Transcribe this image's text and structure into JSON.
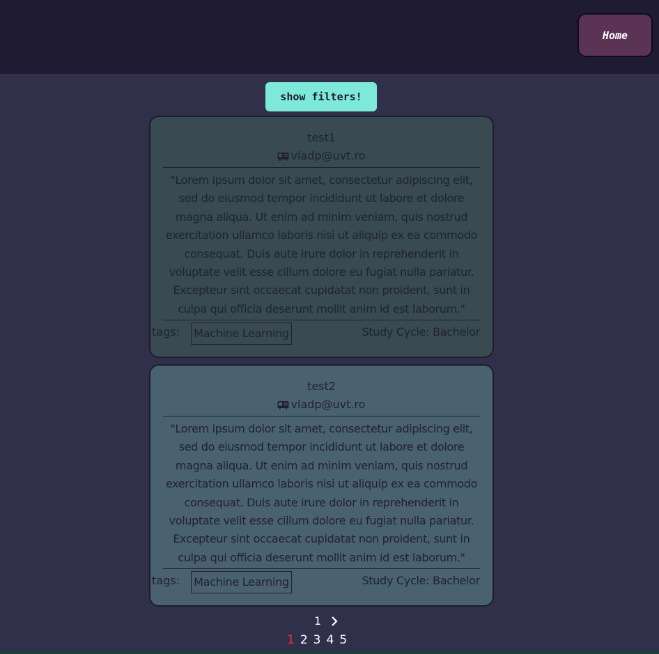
{
  "header": {
    "home_label": "Home"
  },
  "filters": {
    "button_label": "show filters!"
  },
  "cards": [
    {
      "title": "test1",
      "email": "vladp@uvt.ro",
      "description": "\"Lorem ipsum dolor sit amet, consectetur adipiscing elit, sed do eiusmod tempor incididunt ut labore et dolore magna aliqua. Ut enim ad minim veniam, quis nostrud exercitation ullamco laboris nisi ut aliquip ex ea commodo consequat. Duis aute irure dolor in reprehenderit in voluptate velit esse cillum dolore eu fugiat nulla pariatur. Excepteur sint occaecat cupidatat non proident, sunt in culpa qui officia deserunt mollit anim id est laborum.\"",
      "tags_label": "tags:",
      "tag": "Machine Learning",
      "study_cycle": "Study Cycle: Bachelor"
    },
    {
      "title": "test2",
      "email": "vladp@uvt.ro",
      "description": "\"Lorem ipsum dolor sit amet, consectetur adipiscing elit, sed do eiusmod tempor incididunt ut labore et dolore magna aliqua. Ut enim ad minim veniam, quis nostrud exercitation ullamco laboris nisi ut aliquip ex ea commodo consequat. Duis aute irure dolor in reprehenderit in voluptate velit esse cillum dolore eu fugiat nulla pariatur. Excepteur sint occaecat cupidatat non proident, sunt in culpa qui officia deserunt mollit anim id est laborum.\"",
      "tags_label": "tags:",
      "tag": "Machine Learning",
      "study_cycle": "Study Cycle: Bachelor"
    }
  ],
  "pagination": {
    "current_page": "1",
    "next_icon": "chevron-right-icon",
    "pages": [
      "1",
      "2",
      "3",
      "4",
      "5"
    ],
    "active_index": 0,
    "active_color": "#e23b3b"
  },
  "icons": {
    "email_icon": "mailbox-icon"
  },
  "colors": {
    "header_bg": "#1e1b33",
    "page_bg": "#30304a",
    "home_button": "#5a3355",
    "filters_button": "#7ee8d9",
    "card1_bg": "#394a52",
    "card2_bg": "#4a6170"
  }
}
